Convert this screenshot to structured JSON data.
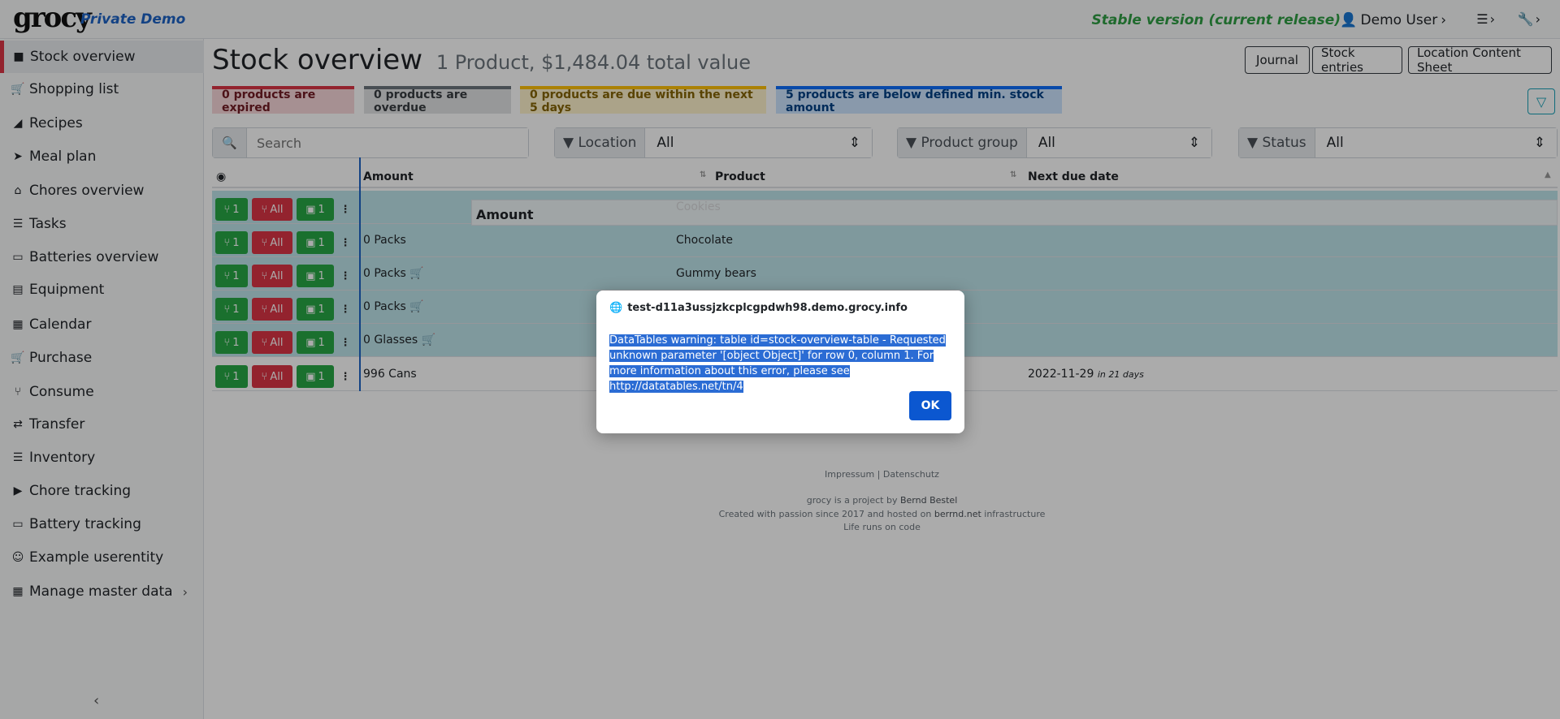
{
  "navbar": {
    "logo": "grocy",
    "demo_tag": "Private Demo",
    "version": "Stable version (current release)",
    "user": "Demo User"
  },
  "sidebar": {
    "items": [
      {
        "label": "Stock overview",
        "icon": "box-icon"
      },
      {
        "label": "Shopping list",
        "icon": "cart-icon"
      },
      {
        "label": "Recipes",
        "icon": "pizza-icon"
      },
      {
        "label": "Meal plan",
        "icon": "paper-plane-icon"
      },
      {
        "label": "Chores overview",
        "icon": "home-icon"
      },
      {
        "label": "Tasks",
        "icon": "tasks-icon"
      },
      {
        "label": "Batteries overview",
        "icon": "battery-icon"
      },
      {
        "label": "Equipment",
        "icon": "toolbox-icon"
      },
      {
        "label": "Calendar",
        "icon": "calendar-icon"
      },
      {
        "label": "Purchase",
        "icon": "cart-plus-icon"
      },
      {
        "label": "Consume",
        "icon": "utensils-icon"
      },
      {
        "label": "Transfer",
        "icon": "exchange-icon"
      },
      {
        "label": "Inventory",
        "icon": "list-icon"
      },
      {
        "label": "Chore tracking",
        "icon": "play-icon"
      },
      {
        "label": "Battery tracking",
        "icon": "battery-icon"
      },
      {
        "label": "Example userentity",
        "icon": "smile-icon"
      },
      {
        "label": "Manage master data",
        "icon": "table-icon"
      }
    ]
  },
  "header": {
    "title": "Stock overview",
    "subtitle": "1 Product, $1,484.04 total value",
    "buttons": [
      "Journal",
      "Stock entries",
      "Location Content Sheet"
    ]
  },
  "badges": [
    {
      "label": "0 products are expired",
      "color": "#dc3545",
      "bg": "#f8d7da",
      "text": "#721c24"
    },
    {
      "label": "0 products are overdue",
      "color": "#6c757d",
      "bg": "#e2e3e5",
      "text": "#383d41"
    },
    {
      "label": "0 products are due within the next 5 days",
      "color": "#ffc107",
      "bg": "#fff3cd",
      "text": "#856404"
    },
    {
      "label": "5 products are below defined min. stock amount",
      "color": "#0d6efd",
      "bg": "#cce5ff",
      "text": "#004085"
    }
  ],
  "filters": {
    "search_placeholder": "Search",
    "location_label": "Location",
    "location_value": "All",
    "product_group_label": "Product group",
    "product_group_value": "All",
    "status_label": "Status",
    "status_value": "All"
  },
  "table": {
    "columns": [
      "Amount",
      "Product",
      "Next due date"
    ],
    "drag_ghost": "Amount",
    "rows": [
      {
        "amount": "",
        "product": "Cookies",
        "due": "",
        "due_rel": "",
        "cart": false,
        "highlight": true
      },
      {
        "amount": "0 Packs",
        "product": "Chocolate",
        "due": "",
        "due_rel": "",
        "cart": false,
        "highlight": true
      },
      {
        "amount": "0 Packs",
        "product": "Gummy bears",
        "due": "",
        "due_rel": "",
        "cart": true,
        "highlight": true
      },
      {
        "amount": "0 Packs",
        "product": "",
        "due": "",
        "due_rel": "",
        "cart": true,
        "highlight": true
      },
      {
        "amount": "0 Glasses",
        "product": "",
        "due": "",
        "due_rel": "",
        "cart": true,
        "highlight": true
      },
      {
        "amount": "996 Cans",
        "product": "",
        "due": "2022-11-29",
        "due_rel": "in 21 days",
        "cart": false,
        "highlight": false
      }
    ],
    "consume_one": "1",
    "consume_all": "All",
    "open_one": "1"
  },
  "footer": {
    "links": "Impressum | Datenschutz",
    "line1_pre": "grocy is a project by",
    "line1_name": "Bernd Bestel",
    "line2_pre": "Created with passion since 2017 and hosted on",
    "line2_host": "berrnd.net",
    "line2_post": "infrastructure",
    "line3": "Life runs on code"
  },
  "dialog": {
    "origin": "test-d11a3ussjzkcplcgpdwh98.demo.grocy.info",
    "message": "DataTables warning: table id=stock-overview-table - Requested unknown parameter '[object Object]' for row 0, column 1. For more information about this error, please see http://datatables.net/tn/4",
    "ok": "OK"
  }
}
